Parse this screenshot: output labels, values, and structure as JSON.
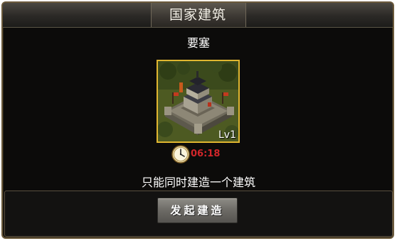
{
  "dialog": {
    "title": "国家建筑",
    "building_name": "要塞",
    "level": "Lv1",
    "timer": "06:18",
    "limit_text": "只能同时建造一个建筑",
    "build_button_label": "发起建造"
  },
  "icons": {
    "timer": "clock-icon",
    "building": "fortress-thumbnail"
  },
  "colors": {
    "frame_gold": "#e0b630",
    "timer_red": "#d2262a",
    "background": "#0c0b0a"
  }
}
